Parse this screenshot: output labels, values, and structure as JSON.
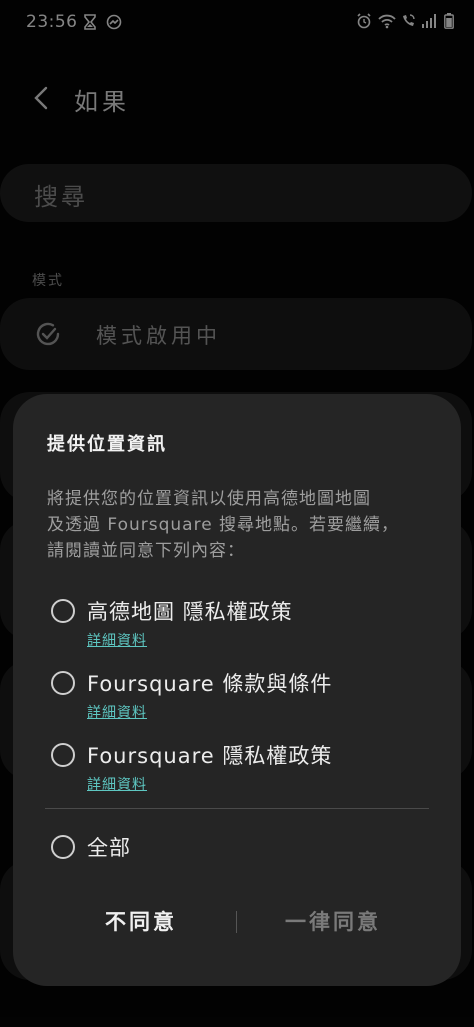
{
  "status_bar": {
    "time": "23:56",
    "left_icons": [
      "hourglass-icon",
      "messenger-icon"
    ],
    "right_icons": [
      "alarm-icon",
      "wifi-icon",
      "wifi-calling-icon",
      "signal-icon",
      "battery-icon"
    ]
  },
  "header": {
    "title": "如果"
  },
  "background": {
    "search_placeholder": "搜尋",
    "section_label": "模式",
    "mode_status": "模式啟用中"
  },
  "dialog": {
    "title": "提供位置資訊",
    "body_lines": [
      "將提供您的位置資訊以使用高德地圖地圖",
      "及透過 Foursquare 搜尋地點。若要繼續，",
      "請閱讀並同意下列內容："
    ],
    "options": [
      {
        "label": "高德地圖 隱私權政策",
        "link": "詳細資料"
      },
      {
        "label": "Foursquare 條款與條件",
        "link": "詳細資料"
      },
      {
        "label": "Foursquare 隱私權政策",
        "link": "詳細資料"
      }
    ],
    "all_label": "全部",
    "decline_label": "不同意",
    "accept_label": "一律同意"
  },
  "colors": {
    "dialog_bg": "#252525",
    "link": "#5ec7c2",
    "accept_disabled": "#7a7a7a"
  }
}
